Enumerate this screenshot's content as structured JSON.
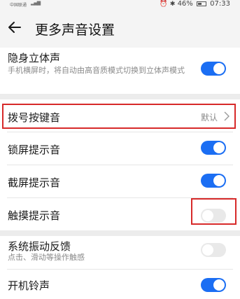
{
  "status_bar": {
    "carrier": "中国联通",
    "battery": "46%",
    "time": "07:33"
  },
  "header": {
    "title": "更多声音设置"
  },
  "items": {
    "stealth_stereo": {
      "label": "隐身立体声",
      "description": "手机横屏时，将自动由高音质模式切换到立体声模式",
      "enabled": true
    },
    "dial_tone": {
      "label": "拨号按键音",
      "value": "默认"
    },
    "lock_sound": {
      "label": "锁屏提示音",
      "enabled": true
    },
    "screenshot_sound": {
      "label": "截屏提示音",
      "enabled": true
    },
    "touch_sound": {
      "label": "触摸提示音",
      "enabled": false
    },
    "vibration_feedback": {
      "label": "系统振动反馈",
      "description": "点击、滑动等操作触感",
      "enabled": false
    },
    "boot_sound": {
      "label": "开机铃声",
      "enabled": true
    }
  },
  "colors": {
    "accent": "#1b6ef3",
    "highlight": "#d72a2a"
  }
}
